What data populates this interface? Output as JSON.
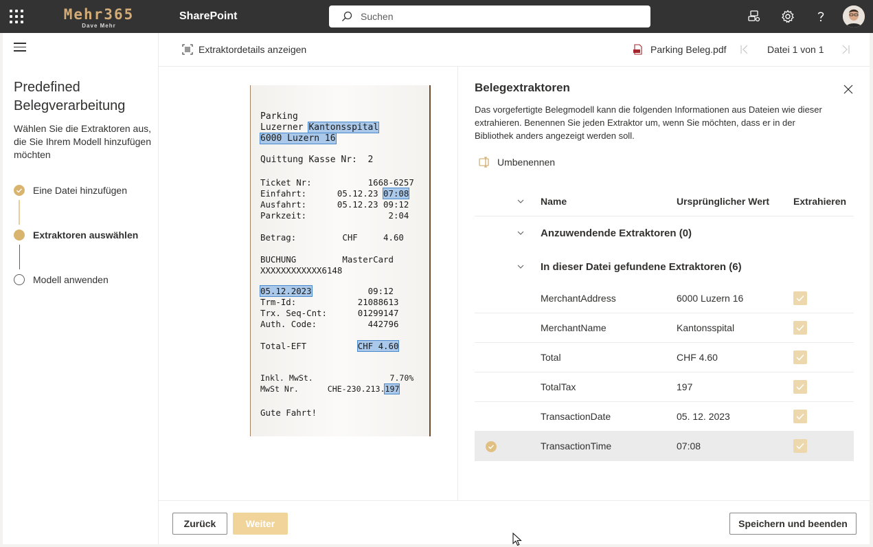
{
  "header": {
    "logo_main": "Mehr365",
    "logo_sub": "Dave Mehr",
    "app_name": "SharePoint",
    "search_placeholder": "Suchen"
  },
  "left_panel": {
    "title": "Predefined Belegverarbeitung",
    "description": "Wählen Sie die Extraktoren aus, die Sie Ihrem Modell hinzufügen möchten",
    "steps": [
      {
        "label": "Eine Datei hinzufügen",
        "status": "done"
      },
      {
        "label": "Extraktoren auswählen",
        "status": "current"
      },
      {
        "label": "Modell anwenden",
        "status": "pending"
      }
    ]
  },
  "command_bar": {
    "details_label": "Extraktordetails anzeigen",
    "file_name": "Parking Beleg.pdf",
    "file_counter": "Datei 1 von 1"
  },
  "receipt": {
    "lines": {
      "l1": "Parking",
      "l2a": "Luzerner ",
      "l2b": "Kantonsspital",
      "l3": "6000 Luzern 16",
      "l4": "Quittung Kasse Nr:  2",
      "l5": "Ticket Nr:           1668-6257",
      "l6a": "Einfahrt:      05.12.23 ",
      "l6b": "07:08",
      "l7": "Ausfahrt:      05.12.23 09:12",
      "l8": "Parkzeit:                2:04",
      "l9": "Betrag:         CHF     4.60",
      "l10": "BUCHUNG         MasterCard",
      "l11": "XXXXXXXXXXXX6148",
      "l12a": "05.12.2023",
      "l12b": "           09:12",
      "l13": "Trm-Id:            21088613",
      "l14": "Trx. Seq-Cnt:      01299147",
      "l15": "Auth. Code:          442796",
      "l16a": "Total-EFT          ",
      "l16b": "CHF 4.60",
      "l17": "Inkl. MwSt.                7.70%",
      "l18a": "MwSt Nr.      CHE-230.213.",
      "l18b": "197",
      "l19": "Gute Fahrt!"
    }
  },
  "right_panel": {
    "title": "Belegextraktoren",
    "description": "Das vorgefertigte Belegmodell kann die folgenden Informationen aus Dateien wie dieser extrahieren. Benennen Sie jeden Extraktor um, wenn Sie möchten, dass er in der Bibliothek anders angezeigt werden soll.",
    "rename_label": "Umbenennen",
    "columns": {
      "name": "Name",
      "original": "Ursprünglicher Wert",
      "extract": "Extrahieren"
    },
    "groups": {
      "applied": "Anzuwendende Extraktoren (0)",
      "found": "In dieser Datei gefundene Extraktoren (6)"
    },
    "rows": [
      {
        "name": "MerchantAddress",
        "value": "6000 Luzern 16",
        "checked": true
      },
      {
        "name": "MerchantName",
        "value": "Kantonsspital",
        "checked": true
      },
      {
        "name": "Total",
        "value": "CHF 4.60",
        "checked": true
      },
      {
        "name": "TotalTax",
        "value": "197",
        "checked": true
      },
      {
        "name": "TransactionDate",
        "value": "05. 12. 2023",
        "checked": true
      },
      {
        "name": "TransactionTime",
        "value": "07:08",
        "checked": true,
        "selected": true
      }
    ]
  },
  "footer": {
    "back_label": "Zurück",
    "next_label": "Weiter",
    "save_label": "Speichern und beenden"
  },
  "colors": {
    "accent": "#d4ac78",
    "step_done": "#d8b46f",
    "checkbox": "#edd8ad",
    "primary_disabled": "#f0d49a",
    "topbar": "#333333"
  }
}
